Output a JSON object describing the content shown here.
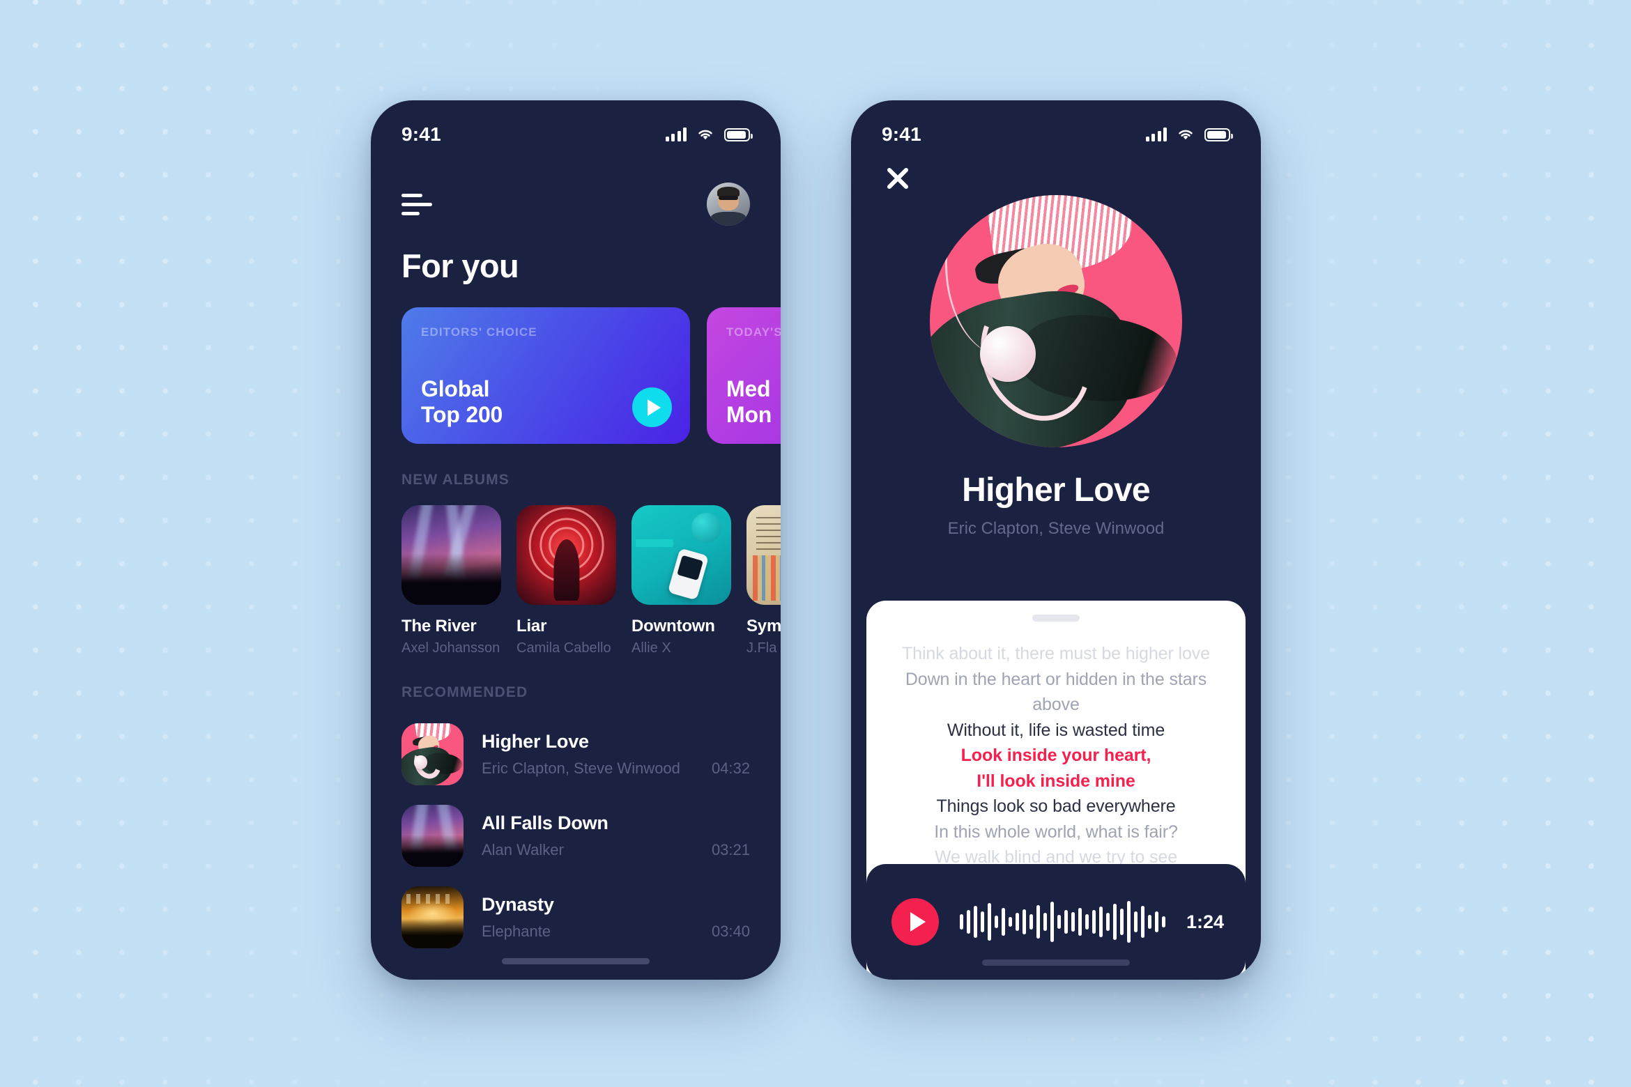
{
  "background": {
    "color": "#c3e0f5",
    "dot_color": "#ffffff"
  },
  "theme": {
    "dark_navy": "#1b2141",
    "accent_pink": "#f4214f",
    "accent_cyan": "#0fdced",
    "muted_text": "#5b6285"
  },
  "home_screen": {
    "status_bar": {
      "time": "9:41",
      "signal": "signal-bars-icon",
      "wifi": "wifi-icon",
      "battery": "battery-icon"
    },
    "menu_icon": "hamburger-menu-icon",
    "avatar": "user-avatar",
    "title": "For you",
    "feature_cards": [
      {
        "kicker": "EDITORS' CHOICE",
        "title": "Global\nTop 200",
        "has_play": true,
        "theme": "blue"
      },
      {
        "kicker": "TODAY'S",
        "title": "Med\nMon",
        "has_play": false,
        "theme": "purple"
      }
    ],
    "sections": {
      "new_albums": "NEW ALBUMS",
      "recommended": "RECOMMENDED"
    },
    "albums": [
      {
        "name": "The River",
        "artist": "Axel Johansson",
        "art": "concert"
      },
      {
        "name": "Liar",
        "artist": "Camila Cabello",
        "art": "neon"
      },
      {
        "name": "Downtown",
        "artist": "Allie X",
        "art": "teal"
      },
      {
        "name": "Symp",
        "artist": "J.Fla",
        "art": "vintage"
      }
    ],
    "recommended": [
      {
        "title": "Higher Love",
        "artist": "Eric Clapton, Steve Winwood",
        "duration": "04:32",
        "art": "pink"
      },
      {
        "title": "All Falls Down",
        "artist": "Alan Walker",
        "duration": "03:21",
        "art": "concert"
      },
      {
        "title": "Dynasty",
        "artist": "Elephante",
        "duration": "03:40",
        "art": "orange"
      }
    ]
  },
  "player_screen": {
    "status_bar": {
      "time": "9:41",
      "signal": "signal-bars-icon",
      "wifi": "wifi-icon",
      "battery": "battery-icon"
    },
    "close_icon": "close-x-icon",
    "cover_art": "pink",
    "song_title": "Higher Love",
    "song_artist": "Eric Clapton, Steve Winwood",
    "lyrics": [
      {
        "text": "Think about it, there must be higher love",
        "state": "faint"
      },
      {
        "text": "Down in the heart or hidden in the stars above",
        "state": "dim"
      },
      {
        "text": "Without it, life is wasted time",
        "state": "normal"
      },
      {
        "text": "Look inside your heart,",
        "state": "active"
      },
      {
        "text": "I'll look inside mine",
        "state": "active"
      },
      {
        "text": "Things look so bad everywhere",
        "state": "normal"
      },
      {
        "text": "In this whole world, what is fair?",
        "state": "dim"
      },
      {
        "text": "We walk blind and we try to see",
        "state": "faint"
      }
    ],
    "player": {
      "play_icon": "play-button-icon",
      "waveform": [
        22,
        34,
        46,
        30,
        54,
        18,
        40,
        14,
        26,
        36,
        22,
        48,
        26,
        58,
        20,
        34,
        28,
        40,
        22,
        34,
        44,
        26,
        52,
        38,
        60,
        30,
        46,
        20,
        30,
        16
      ],
      "elapsed": "1:24"
    }
  }
}
